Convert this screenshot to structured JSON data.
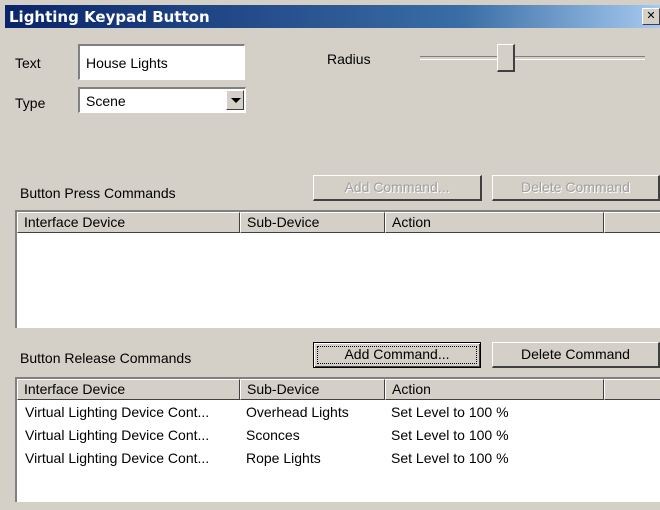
{
  "window": {
    "title": "Lighting Keypad Button",
    "close_glyph": "✕"
  },
  "form": {
    "text_label": "Text",
    "text_value": "House Lights",
    "type_label": "Type",
    "type_value": "Scene",
    "radius_label": "Radius",
    "radius_level": 0.38
  },
  "press": {
    "label": "Button Press Commands",
    "add_label": "Add Command...",
    "delete_label": "Delete Command",
    "columns": [
      "Interface Device",
      "Sub-Device",
      "Action",
      ""
    ],
    "rows": []
  },
  "release": {
    "label": "Button Release Commands",
    "add_label": "Add Command...",
    "delete_label": "Delete Command",
    "columns": [
      "Interface Device",
      "Sub-Device",
      "Action",
      ""
    ],
    "rows": [
      [
        "Virtual Lighting Device Cont...",
        "Overhead Lights",
        "Set Level to 100 %"
      ],
      [
        "Virtual Lighting Device Cont...",
        "Sconces",
        "Set Level to 100 %"
      ],
      [
        "Virtual Lighting Device Cont...",
        "Rope Lights",
        "Set Level to 100 %"
      ]
    ]
  },
  "icons": {
    "dropdown": "chevron-down-icon",
    "close": "close-icon"
  }
}
